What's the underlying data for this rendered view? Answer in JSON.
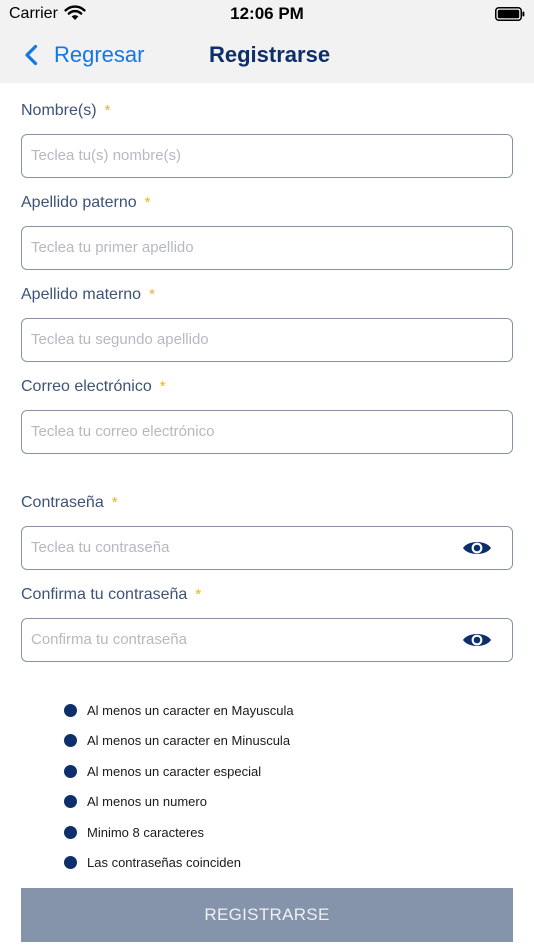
{
  "status_bar": {
    "carrier": "Carrier",
    "time": "12:06 PM",
    "icons": [
      "wifi-icon",
      "battery-icon"
    ]
  },
  "nav": {
    "back_label": "Regresar",
    "title": "Registrarse",
    "accent_color": "#1577e6",
    "title_color": "#0d2f6b"
  },
  "form": {
    "required_marker": "*",
    "fields": [
      {
        "label": "Nombre(s)",
        "placeholder": "Teclea tu(s) nombre(s)",
        "value": ""
      },
      {
        "label": "Apellido paterno",
        "placeholder": "Teclea tu primer apellido",
        "value": ""
      },
      {
        "label": "Apellido materno",
        "placeholder": "Teclea tu segundo apellido",
        "value": ""
      },
      {
        "label": "Correo electrónico",
        "placeholder": "Teclea tu correo electrónico",
        "value": ""
      },
      {
        "label": "Contraseña",
        "placeholder": "Teclea tu contraseña",
        "value": "",
        "icon": "eye-icon"
      },
      {
        "label": "Confirma tu contraseña",
        "placeholder": "Confirma tu contraseña",
        "value": "",
        "icon": "eye-icon"
      }
    ]
  },
  "password_rules": [
    "Al menos un caracter en Mayuscula",
    "Al menos un caracter en Minuscula",
    "Al menos un caracter especial",
    "Al menos un numero",
    "Minimo 8 caracteres",
    "Las contraseñas coinciden"
  ],
  "submit_label": "REGISTRARSE",
  "colors": {
    "rule_dot": "#0d2f6b",
    "required_star": "#f5b400",
    "button_disabled": "#8594ab"
  }
}
